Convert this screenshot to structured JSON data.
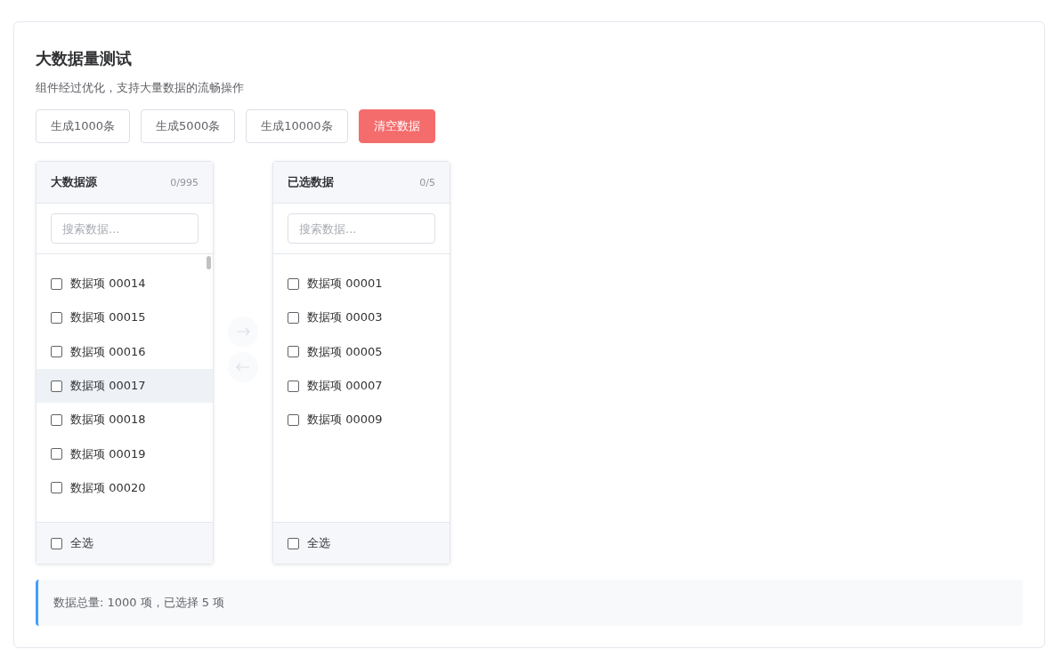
{
  "title": "大数据量测试",
  "subtitle": "组件经过优化，支持大量数据的流畅操作",
  "buttons": [
    {
      "label": "生成1000条",
      "kind": "default"
    },
    {
      "label": "生成5000条",
      "kind": "default"
    },
    {
      "label": "生成10000条",
      "kind": "default"
    },
    {
      "label": "清空数据",
      "kind": "danger"
    }
  ],
  "panels": [
    {
      "title": "大数据源",
      "count": "0/995",
      "search": {
        "placeholder": "搜索数据..."
      },
      "scrollbar": true,
      "items": [
        {
          "label": "数据项 00014",
          "checked": false,
          "hovered": false
        },
        {
          "label": "数据项 00015",
          "checked": false,
          "hovered": false
        },
        {
          "label": "数据项 00016",
          "checked": false,
          "hovered": false
        },
        {
          "label": "数据项 00017",
          "checked": false,
          "hovered": true
        },
        {
          "label": "数据项 00018",
          "checked": false,
          "hovered": false
        },
        {
          "label": "数据项 00019",
          "checked": false,
          "hovered": false
        },
        {
          "label": "数据项 00020",
          "checked": false,
          "hovered": false
        }
      ],
      "footer": {
        "label": "全选",
        "checked": false
      }
    },
    {
      "title": "已选数据",
      "count": "0/5",
      "search": {
        "placeholder": "搜索数据..."
      },
      "scrollbar": false,
      "items": [
        {
          "label": "数据项 00001",
          "checked": false,
          "hovered": false
        },
        {
          "label": "数据项 00003",
          "checked": false,
          "hovered": false
        },
        {
          "label": "数据项 00005",
          "checked": false,
          "hovered": false
        },
        {
          "label": "数据项 00007",
          "checked": false,
          "hovered": false
        },
        {
          "label": "数据项 00009",
          "checked": false,
          "hovered": false
        }
      ],
      "footer": {
        "label": "全选",
        "checked": false
      }
    }
  ],
  "transfer_buttons": [
    {
      "kind": "right",
      "disabled": true
    },
    {
      "kind": "left",
      "disabled": true
    }
  ],
  "info": "数据总量: 1000 项，已选择 5 项"
}
